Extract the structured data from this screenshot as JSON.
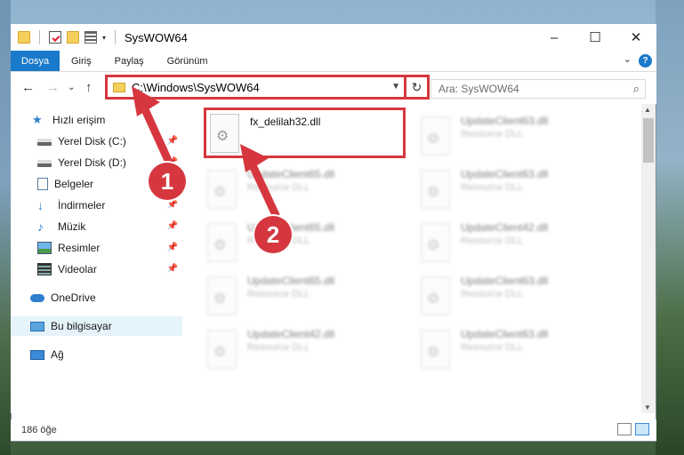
{
  "window": {
    "title": "SysWOW64"
  },
  "window_controls": {
    "minimize": "–",
    "maximize": "☐",
    "close": "✕"
  },
  "ribbon": {
    "tabs": [
      {
        "label": "Dosya",
        "active": true
      },
      {
        "label": "Giriş"
      },
      {
        "label": "Paylaş"
      },
      {
        "label": "Görünüm"
      }
    ],
    "help": "?"
  },
  "nav": {
    "back": "←",
    "forward": "→",
    "dropdown": "⌄",
    "up": "↑",
    "address": "C:\\Windows\\SysWOW64",
    "refresh": "↻",
    "search_placeholder": "Ara: SysWOW64"
  },
  "sidebar": {
    "items": [
      {
        "label": "Hızlı erişim",
        "icon": "star-icon"
      },
      {
        "label": "Yerel Disk (C:)",
        "icon": "drive-icon",
        "pinned": true
      },
      {
        "label": "Yerel Disk (D:)",
        "icon": "drive-icon",
        "pinned": true
      },
      {
        "label": "Belgeler",
        "icon": "document-icon",
        "pinned": true
      },
      {
        "label": "İndirmeler",
        "icon": "download-icon",
        "pinned": true
      },
      {
        "label": "Müzik",
        "icon": "music-icon",
        "pinned": true
      },
      {
        "label": "Resimler",
        "icon": "pictures-icon",
        "pinned": true
      },
      {
        "label": "Videolar",
        "icon": "videos-icon",
        "pinned": true
      },
      {
        "label": "OneDrive",
        "icon": "cloud-icon"
      },
      {
        "label": "Bu bilgisayar",
        "icon": "computer-icon",
        "selected": true
      },
      {
        "label": "Ağ",
        "icon": "network-icon"
      }
    ]
  },
  "files": {
    "highlighted": {
      "name": "fx_delilah32.dll",
      "type": ""
    },
    "blurred": [
      {
        "name": "UpdateClient63.dll",
        "type": "Resource DLL"
      },
      {
        "name": "UpdateClient65.dll",
        "type": "Resource DLL"
      },
      {
        "name": "UpdateClient63.dll",
        "type": "Resource DLL"
      },
      {
        "name": "UpdateClient65.dll",
        "type": "Resource DLL"
      },
      {
        "name": "UpdateClient42.dll",
        "type": "Resource DLL"
      },
      {
        "name": "UpdateClient65.dll",
        "type": "Resource DLL"
      },
      {
        "name": "UpdateClient63.dll",
        "type": "Resource DLL"
      },
      {
        "name": "UpdateClient42.dll",
        "type": "Resource DLL"
      },
      {
        "name": "UpdateClient63.dll",
        "type": "Resource DLL"
      }
    ]
  },
  "status": {
    "item_count": "186 öğe"
  },
  "markers": [
    {
      "label": "1"
    },
    {
      "label": "2"
    }
  ],
  "colors": {
    "accent": "#1979ca",
    "highlight": "#d6373f"
  }
}
